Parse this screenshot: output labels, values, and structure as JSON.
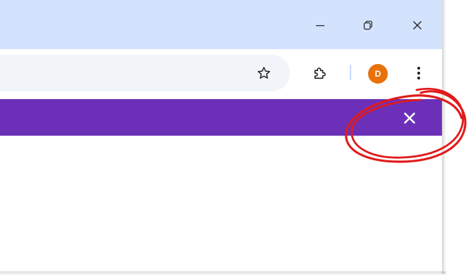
{
  "window": {
    "controls": {
      "minimize_icon": "minimize-icon",
      "restore_icon": "restore-icon",
      "close_icon": "close-icon"
    }
  },
  "toolbar": {
    "bookmark_icon": "star-outline-icon",
    "extensions_icon": "puzzle-piece-icon",
    "profile_initial": "D",
    "menu_icon": "vertical-dots-icon"
  },
  "banner": {
    "close_icon": "close-icon"
  },
  "colors": {
    "titlebar": "#d3e3fd",
    "omnibox": "#f1f4f8",
    "banner": "#6c30b8",
    "avatar": "#e8710a",
    "separator": "#c6dafc",
    "annotation": "#e01b1b"
  }
}
